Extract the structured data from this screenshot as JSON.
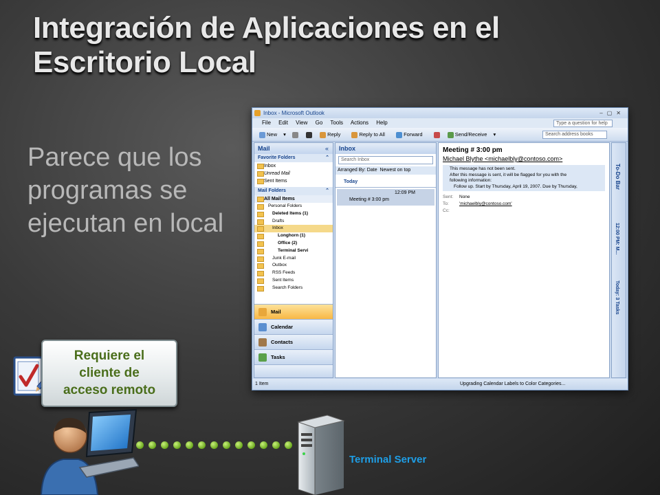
{
  "slide": {
    "title": "Integración de Aplicaciones en el Escritorio Local",
    "subtitle": "Parece que los programas se ejecutan en local"
  },
  "outlook": {
    "window_title": "Inbox - Microsoft Outlook",
    "menu": [
      "File",
      "Edit",
      "View",
      "Go",
      "Tools",
      "Actions",
      "Help"
    ],
    "help_placeholder": "Type a question for help",
    "toolbar": {
      "new": "New",
      "reply": "Reply",
      "reply_all": "Reply to All",
      "forward": "Forward",
      "send_receive": "Send/Receive",
      "address_placeholder": "Search address books"
    },
    "nav_pane": {
      "title": "Mail",
      "favorite_header": "Favorite Folders",
      "favorites": [
        "Inbox",
        "Unread Mail",
        "Sent Items"
      ],
      "mail_folders_header": "Mail Folders",
      "all_mail": "All Mail Items",
      "folders": [
        {
          "label": "Personal Folders",
          "bold": false
        },
        {
          "label": "Deleted Items (1)",
          "bold": true
        },
        {
          "label": "Drafts",
          "bold": false
        },
        {
          "label": "Inbox",
          "bold": false
        },
        {
          "label": "Longhorn (1)",
          "bold": true
        },
        {
          "label": "Office (2)",
          "bold": true
        },
        {
          "label": "Terminal Servi",
          "bold": true
        },
        {
          "label": "Junk E-mail",
          "bold": false
        },
        {
          "label": "Outbox",
          "bold": false
        },
        {
          "label": "RSS Feeds",
          "bold": false
        },
        {
          "label": "Sent Items",
          "bold": false
        },
        {
          "label": "Search Folders",
          "bold": false
        }
      ],
      "buttons": [
        "Mail",
        "Calendar",
        "Contacts",
        "Tasks"
      ]
    },
    "list_pane": {
      "title": "Inbox",
      "search_placeholder": "Search Inbox",
      "arranged": "Arranged By: Date",
      "order": "Newest on top",
      "group": "Today",
      "message": {
        "time": "12:09 PM",
        "subject": "Meeting # 3:00 pm"
      }
    },
    "reading_pane": {
      "subject": "Meeting # 3:00 pm",
      "from": "Michael Blythe <michaelbly@contoso.com>",
      "info": [
        "This message has not been sent.",
        "After this message is sent, it will be flagged for you with the",
        "following information:",
        "Follow up.  Start by Thursday, April 19, 2007.  Due by Thursday,"
      ],
      "sent_label": "Sent:",
      "sent_value": "None",
      "to_label": "To:",
      "to_value": "'michaelbly@contoso.com'",
      "cc_label": "Cc:"
    },
    "todo_bar": {
      "title": "To-Do Bar",
      "calendar": "12:00 PM: M...",
      "tasks": "Today: 3 Tasks"
    },
    "status_left": "1 Item",
    "status_right": "Upgrading Calendar Labels to Color Categories..."
  },
  "callout": {
    "lines": [
      "Requiere el",
      "cliente de",
      "acceso remoto"
    ]
  },
  "server_label": "Terminal Server"
}
